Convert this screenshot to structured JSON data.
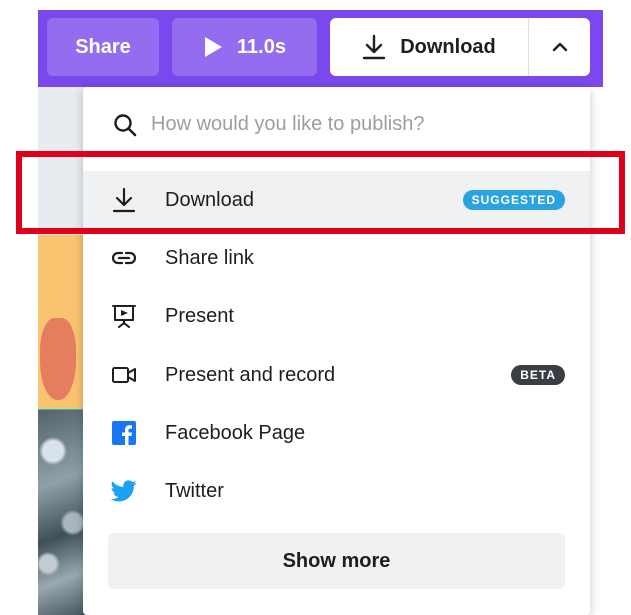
{
  "topbar": {
    "share_label": "Share",
    "play_duration": "11.0s",
    "download_label": "Download",
    "accent_color": "#7a48ec"
  },
  "publish_menu": {
    "search_placeholder": "How would you like to publish?",
    "items": [
      {
        "label": "Download",
        "icon": "download-icon",
        "badge": "SUGGESTED"
      },
      {
        "label": "Share link",
        "icon": "link-icon"
      },
      {
        "label": "Present",
        "icon": "present-icon"
      },
      {
        "label": "Present and record",
        "icon": "record-icon",
        "badge": "BETA"
      },
      {
        "label": "Facebook Page",
        "icon": "facebook-icon"
      },
      {
        "label": "Twitter",
        "icon": "twitter-icon"
      }
    ],
    "show_more_label": "Show more"
  },
  "colors": {
    "highlight_box": "#e0001a",
    "suggested_badge": "#2aa3e0",
    "beta_badge": "#3a3d44",
    "facebook": "#1877f2",
    "twitter": "#1da1f2"
  }
}
